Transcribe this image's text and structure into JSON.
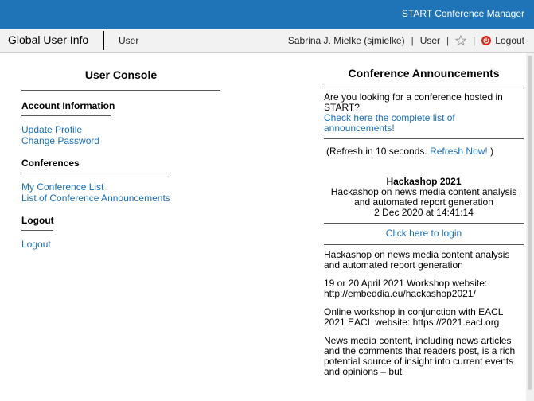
{
  "header": {
    "brand": "START Conference Manager"
  },
  "navbar": {
    "global_user_info": "Global User Info",
    "user_tab": "User",
    "username": "Sabrina J. Mielke (sjmielke)",
    "sep1": "|",
    "user_link": "User",
    "sep2": "|",
    "sep3": "|",
    "logout": "Logout"
  },
  "user_console": {
    "title": "User Console",
    "sections": [
      {
        "title": "Account Information",
        "links": [
          "Update Profile",
          "Change Password"
        ]
      },
      {
        "title": "Conferences",
        "links": [
          "My Conference List",
          "List of Conference Announcements"
        ]
      },
      {
        "title": "Logout",
        "links": [
          "Logout"
        ]
      }
    ]
  },
  "announcements": {
    "title": "Conference Announcements",
    "question": "Are you looking for a conference hosted in START?",
    "list_link": "Check here the complete list of announcements!",
    "refresh_prefix": "(Refresh in 10 seconds.",
    "refresh_link": "Refresh Now!",
    "refresh_suffix": ")",
    "featured": {
      "name": "Hackashop 2021",
      "description": "Hackashop on news media content analysis and automated report generation",
      "date": "2 Dec 2020 at 14:41:14",
      "login_link": "Click here to login"
    },
    "paragraphs": [
      "Hackashop on news media content analysis and automated report generation",
      "19 or 20 April 2021 Workshop website: http://embeddia.eu/hackashop2021/",
      "Online workshop in conjunction with EACL 2021 EACL website: https://2021.eacl.org",
      "News media content, including news articles and the comments that readers post, is a rich potential source of insight into current events and opinions – but"
    ]
  },
  "colors": {
    "topbar": "#1f73b7",
    "link": "#1a6fb5",
    "logout_icon": "#d9261c"
  }
}
